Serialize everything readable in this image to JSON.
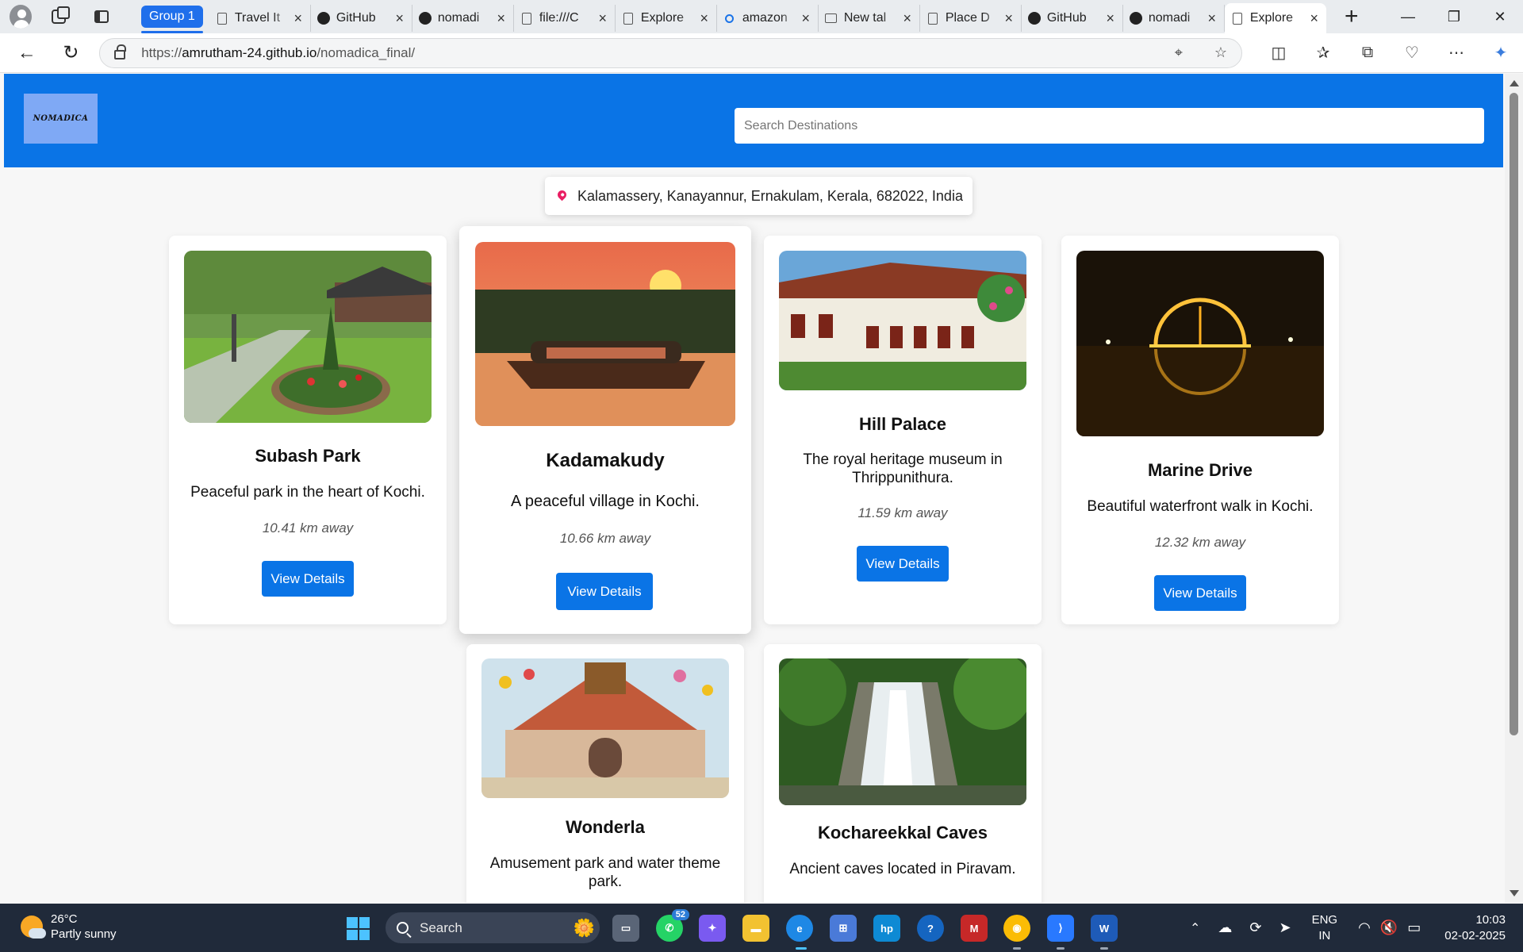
{
  "browser": {
    "group_label": "Group 1",
    "tabs": [
      {
        "title": "Travel It",
        "icon": "page-icon"
      },
      {
        "title": "GitHub",
        "icon": "github-icon"
      },
      {
        "title": "nomadi",
        "icon": "github-icon"
      },
      {
        "title": "file:///C",
        "icon": "page-icon"
      },
      {
        "title": "Explore",
        "icon": "page-icon"
      },
      {
        "title": "amazon",
        "icon": "search-icon"
      },
      {
        "title": "New tal",
        "icon": "newtab-icon"
      },
      {
        "title": "Place D",
        "icon": "page-icon"
      },
      {
        "title": "GitHub",
        "icon": "github-icon"
      },
      {
        "title": "nomadi",
        "icon": "github-icon"
      },
      {
        "title": "Explore",
        "icon": "page-icon",
        "active": true
      }
    ],
    "url_prefix": "https://",
    "url_host": "amrutham-24.github.io",
    "url_path": "/nomadica_final/"
  },
  "site": {
    "logo_text": "NOMADICA",
    "search_placeholder": "Search Destinations",
    "location": "Kalamassery, Kanayannur, Ernakulam, Kerala, 682022, India",
    "cards": [
      {
        "title": "Subash Park",
        "desc": "Peaceful park in the heart of Kochi.",
        "distance": "10.41 km away",
        "button": "View Details",
        "image": "park-photo"
      },
      {
        "title": "Kadamakudy",
        "desc": "A peaceful village in Kochi.",
        "distance": "10.66 km away",
        "button": "View Details",
        "image": "houseboat-sunset-photo"
      },
      {
        "title": "Hill Palace",
        "desc": "The royal heritage museum in Thrippunithura.",
        "distance": "11.59 km away",
        "button": "View Details",
        "image": "palace-photo"
      },
      {
        "title": "Marine Drive",
        "desc": "Beautiful waterfront walk in Kochi.",
        "distance": "12.32 km away",
        "button": "View Details",
        "image": "rainbow-bridge-night-photo"
      },
      {
        "title": "Wonderla",
        "desc": "Amusement park and water theme park.",
        "image": "amusement-park-photo"
      },
      {
        "title": "Kochareekkal Caves",
        "desc": "Ancient caves located in Piravam.",
        "image": "waterfall-photo"
      }
    ]
  },
  "taskbar": {
    "temperature": "26°C",
    "weather": "Partly sunny",
    "search_label": "Search",
    "whatsapp_badge": "52",
    "lang_top": "ENG",
    "lang_bottom": "IN",
    "time": "10:03",
    "date": "02-02-2025"
  },
  "colors": {
    "header_blue": "#0a74e6",
    "logo_bg": "#7fa9f5",
    "taskbar": "#202a3a",
    "pin": "#e91e63"
  }
}
